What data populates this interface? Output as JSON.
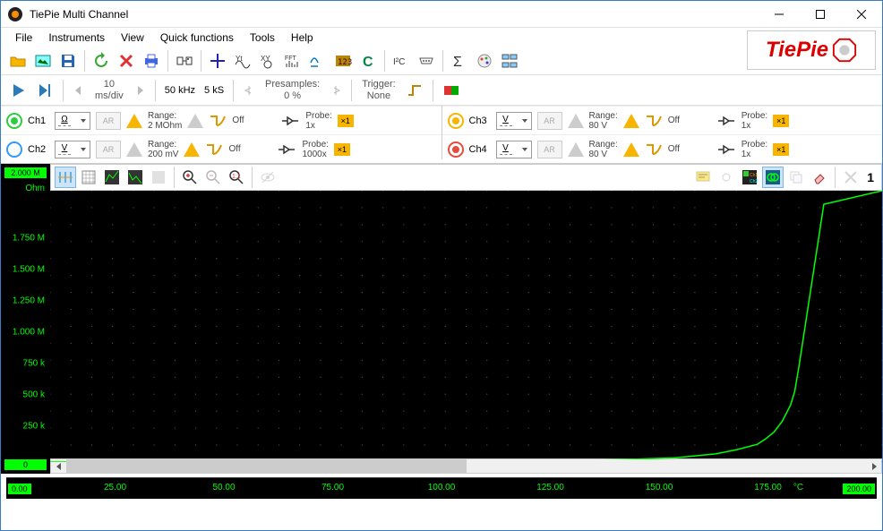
{
  "window": {
    "title": "TiePie Multi Channel"
  },
  "menu": [
    "File",
    "Instruments",
    "View",
    "Quick functions",
    "Tools",
    "Help"
  ],
  "brand": "TiePie",
  "toolbar2": {
    "time": {
      "value": "10",
      "unit": "ms/div"
    },
    "freq": "50 kHz",
    "samples": "5 kS",
    "presamples_label": "Presamples:",
    "presamples_value": "0 %",
    "trigger_label": "Trigger:",
    "trigger_value": "None"
  },
  "channels": [
    {
      "name": "Ch1",
      "color": "#2ecc40",
      "ring": "#2ecc40",
      "unit": "Ω",
      "range_label": "Range:",
      "range": "2 MOhm",
      "off": "Off",
      "probe_label": "Probe:",
      "probe": "1x",
      "tag": "×1",
      "tri": "yellow",
      "tri2": "grey"
    },
    {
      "name": "Ch2",
      "color": "#3399ff",
      "ring": "#3399ff",
      "unit": "V",
      "range_label": "Range:",
      "range": "200 mV",
      "off": "Off",
      "probe_label": "Probe:",
      "probe": "1000x",
      "tag": "×1",
      "tri": "grey",
      "tri2": "yellow"
    },
    {
      "name": "Ch3",
      "color": "#f7b500",
      "ring": "#f7b500",
      "unit": "V",
      "range_label": "Range:",
      "range": "80 V",
      "off": "Off",
      "probe_label": "Probe:",
      "probe": "1x",
      "tag": "×1",
      "tri": "grey",
      "tri2": "yellow"
    },
    {
      "name": "Ch4",
      "color": "#e74c3c",
      "ring": "#e74c3c",
      "unit": "V",
      "range_label": "Range:",
      "range": "80 V",
      "off": "Off",
      "probe_label": "Probe:",
      "probe": "1x",
      "tag": "×1",
      "tri": "grey",
      "tri2": "yellow"
    }
  ],
  "chart_data": {
    "type": "line",
    "title": "",
    "xlabel": "°C",
    "ylabel": "Ohm",
    "xlim": [
      0,
      200
    ],
    "ylim": [
      0,
      2000000
    ],
    "x_ticks": [
      0,
      25,
      50,
      75,
      100,
      125,
      150,
      175,
      200
    ],
    "x_tick_labels": [
      "0.00",
      "25.00",
      "50.00",
      "75.00",
      "100.00",
      "125.00",
      "150.00",
      "175.00",
      "200.00"
    ],
    "y_ticks": [
      0,
      250000,
      500000,
      750000,
      1000000,
      1250000,
      1500000,
      1750000,
      2000000
    ],
    "y_tick_labels": [
      "0",
      "250 k",
      "500 k",
      "750 k",
      "1.000 M",
      "1.250 M",
      "1.500 M",
      "1.750 M",
      "2.000 M"
    ],
    "series": [
      {
        "name": "Ch1",
        "color": "#00ff00",
        "x": [
          0,
          20,
          40,
          60,
          80,
          100,
          120,
          140,
          150,
          160,
          165,
          170,
          172,
          174,
          176,
          178,
          179,
          180,
          181,
          182,
          183,
          184,
          185,
          186,
          200
        ],
        "y": [
          0,
          0,
          0,
          0,
          0,
          0,
          5000,
          20000,
          30000,
          60000,
          90000,
          130000,
          170000,
          220000,
          300000,
          420000,
          520000,
          700000,
          900000,
          1100000,
          1300000,
          1500000,
          1700000,
          1900000,
          2000000
        ]
      }
    ]
  },
  "graph_toolbar_number": "1"
}
